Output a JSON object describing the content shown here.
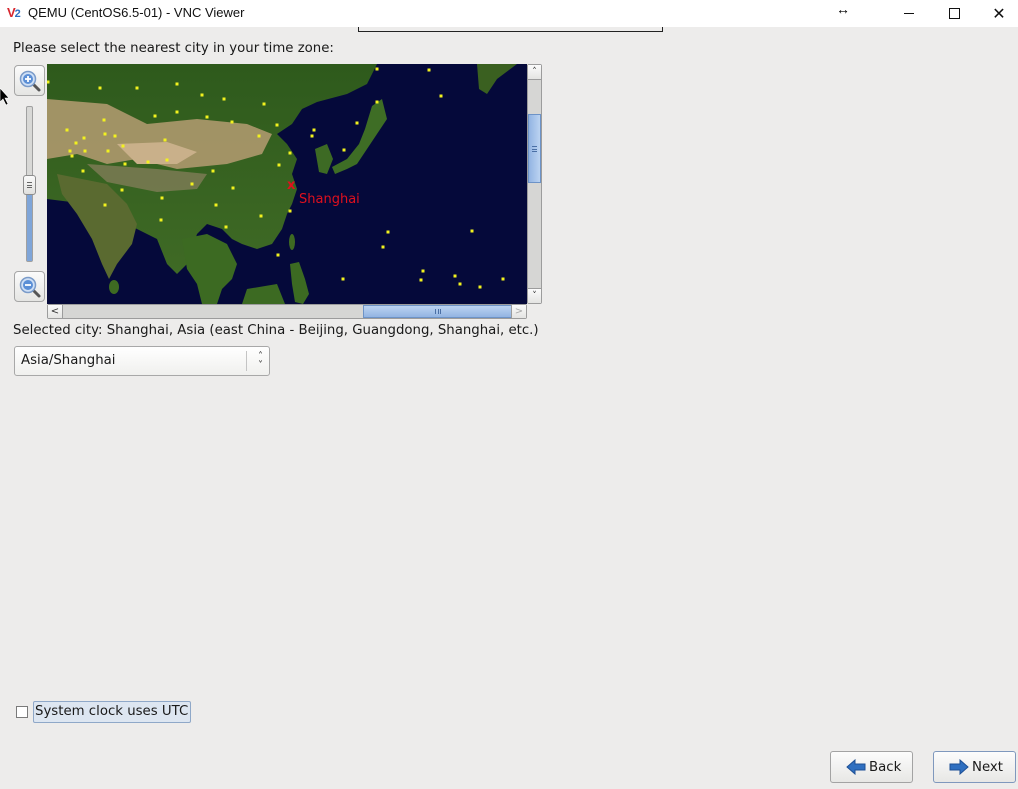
{
  "window": {
    "title": "QEMU (CentOS6.5-01) - VNC Viewer",
    "icon_text_v": "V",
    "icon_text_2": "2",
    "close_glyph": "✕",
    "resize_glyph": "↔"
  },
  "timezone": {
    "prompt": "Please select the nearest city in your time zone:",
    "selected_city_text": "Selected city: Shanghai, Asia (east China - Beijing, Guangdong, Shanghai, etc.)",
    "select_value": "Asia/Shanghai",
    "map_marker_label": "Shanghai",
    "map_marker_glyph": "x",
    "zoom_level_fraction": 0.5,
    "vertical_scroll_position": 0.3,
    "horizontal_scroll_position": 0.72
  },
  "scroll_arrows": {
    "up": "˄",
    "down": "˅",
    "left": "<",
    "right": ">"
  },
  "utc": {
    "label": "System clock uses UTC",
    "checked": false
  },
  "buttons": {
    "back": "Back",
    "next": "Next"
  },
  "colors": {
    "ocean": "#05093a",
    "city_dot": "#f2f21e",
    "marker": "#e0101e",
    "scroll_thumb": "#92b4e2",
    "arrow_blue": "#2f6fc0"
  },
  "select_arrows": {
    "up": "˄",
    "down": "˅"
  }
}
